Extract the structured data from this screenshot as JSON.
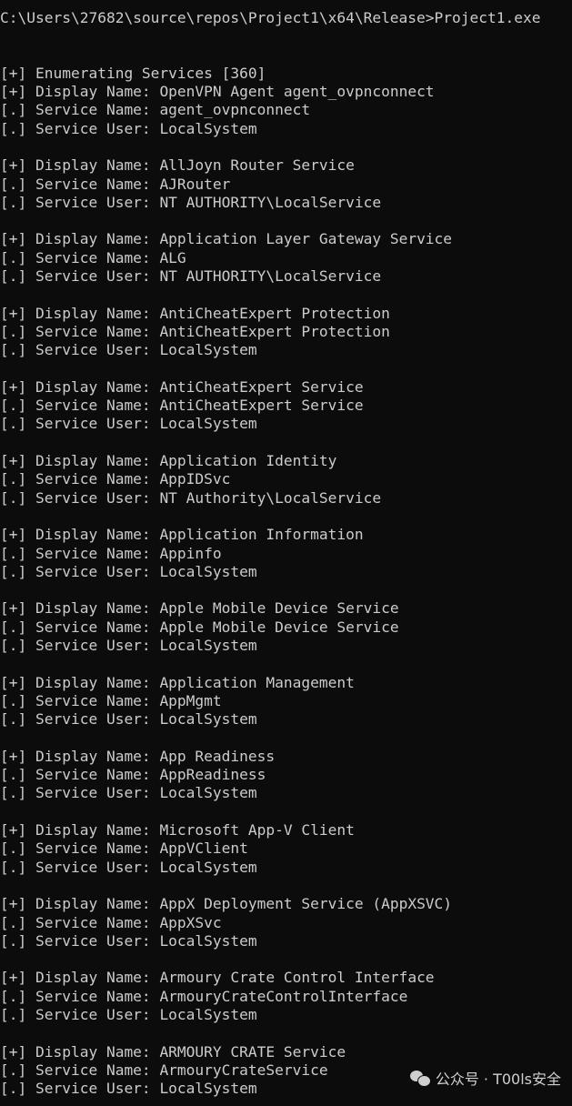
{
  "console": {
    "prompt": "C:\\Users\\27682\\source\\repos\\Project1\\x64\\Release>Project1.exe",
    "header": "[+] Enumerating Services [360]",
    "services": [
      {
        "display": "OpenVPN Agent agent_ovpnconnect",
        "service": "agent_ovpnconnect",
        "user": "LocalSystem"
      },
      {
        "display": "AllJoyn Router Service",
        "service": "AJRouter",
        "user": "NT AUTHORITY\\LocalService"
      },
      {
        "display": "Application Layer Gateway Service",
        "service": "ALG",
        "user": "NT AUTHORITY\\LocalService"
      },
      {
        "display": "AntiCheatExpert Protection",
        "service": "AntiCheatExpert Protection",
        "user": "LocalSystem"
      },
      {
        "display": "AntiCheatExpert Service",
        "service": "AntiCheatExpert Service",
        "user": "LocalSystem"
      },
      {
        "display": "Application Identity",
        "service": "AppIDSvc",
        "user": "NT Authority\\LocalService"
      },
      {
        "display": "Application Information",
        "service": "Appinfo",
        "user": "LocalSystem"
      },
      {
        "display": "Apple Mobile Device Service",
        "service": "Apple Mobile Device Service",
        "user": "LocalSystem"
      },
      {
        "display": "Application Management",
        "service": "AppMgmt",
        "user": "LocalSystem"
      },
      {
        "display": "App Readiness",
        "service": "AppReadiness",
        "user": "LocalSystem"
      },
      {
        "display": "Microsoft App-V Client",
        "service": "AppVClient",
        "user": "LocalSystem"
      },
      {
        "display": "AppX Deployment Service (AppXSVC)",
        "service": "AppXSvc",
        "user": "LocalSystem"
      },
      {
        "display": "Armoury Crate Control Interface",
        "service": "ArmouryCrateControlInterface",
        "user": "LocalSystem"
      },
      {
        "display": "ARMOURY CRATE Service",
        "service": "ArmouryCrateService",
        "user": "LocalSystem"
      }
    ],
    "labels": {
      "display_prefix": "[+] Display Name: ",
      "service_prefix": "[.] Service Name: ",
      "user_prefix": "[.] Service User: "
    }
  },
  "watermark": {
    "text": "公众号 · T00ls安全"
  },
  "colors": {
    "background": "#0c0c0c",
    "text": "#cccccc"
  }
}
